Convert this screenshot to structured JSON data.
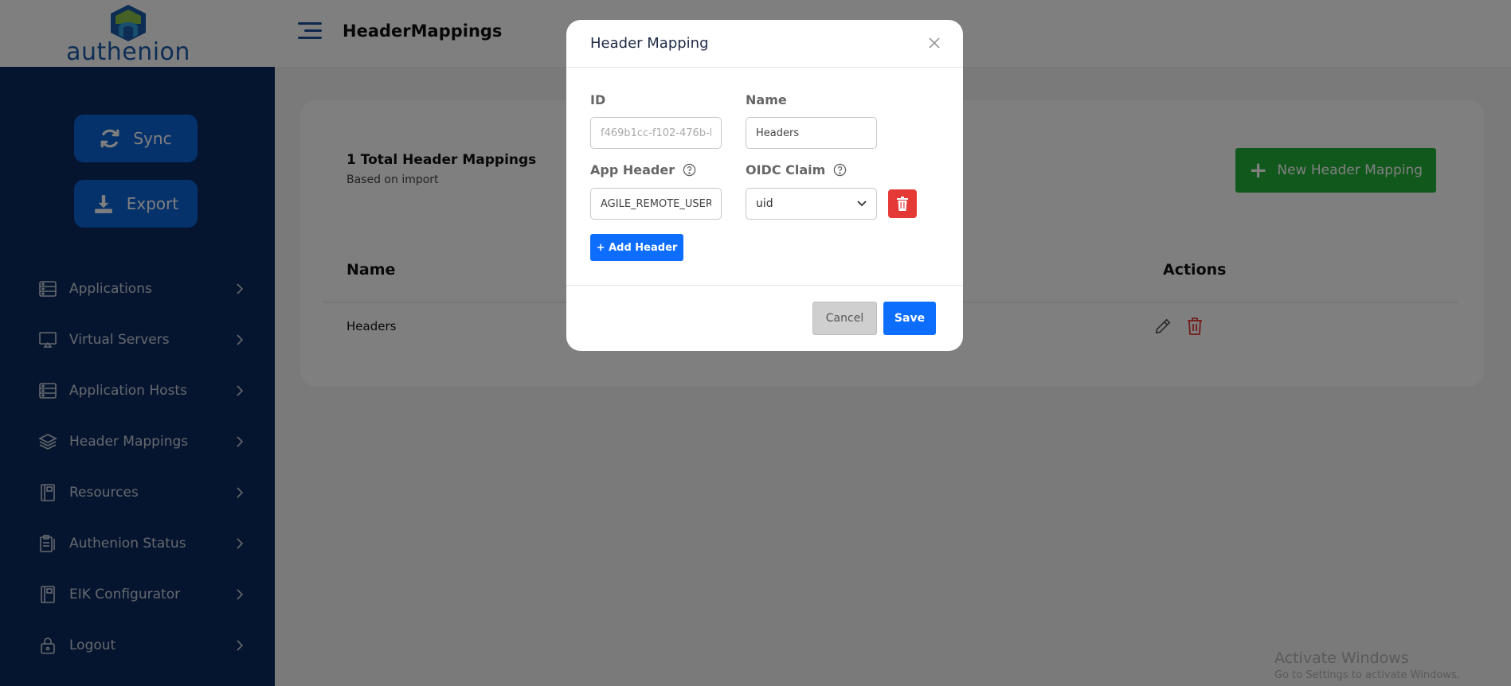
{
  "brand": {
    "logo_text": "authenion"
  },
  "header": {
    "title": "HeaderMappings",
    "menu_icon": "hamburger-icon"
  },
  "sidebar": {
    "sync_label": "Sync",
    "export_label": "Export",
    "items": [
      {
        "label": "Applications",
        "icon": "applications-icon"
      },
      {
        "label": "Virtual Servers",
        "icon": "monitor-icon"
      },
      {
        "label": "Application Hosts",
        "icon": "server-icon"
      },
      {
        "label": "Header Mappings",
        "icon": "layers-icon"
      },
      {
        "label": "Resources",
        "icon": "book-icon"
      },
      {
        "label": "Authenion Status",
        "icon": "clipboard-icon"
      },
      {
        "label": "EIK Configurator",
        "icon": "book-icon"
      },
      {
        "label": "Logout",
        "icon": "lock-icon"
      }
    ]
  },
  "main": {
    "summary_title": "1 Total Header Mappings",
    "summary_sub": "Based on import",
    "new_button_label": "New Header Mapping",
    "table": {
      "headers": {
        "name": "Name",
        "actions": "Actions"
      },
      "rows": [
        {
          "name": "Headers"
        }
      ]
    }
  },
  "watermark": {
    "title": "Activate Windows",
    "subtitle": "Go to Settings to activate Windows."
  },
  "modal": {
    "title": "Header Mapping",
    "id_label": "ID",
    "id_value": "f469b1cc-f102-476b-b",
    "name_label": "Name",
    "name_value": "Headers",
    "app_header_label": "App Header",
    "app_header_value": "AGILE_REMOTE_USER",
    "oidc_label": "OIDC Claim",
    "oidc_value": "uid",
    "add_header_label": "+ Add Header",
    "cancel_label": "Cancel",
    "save_label": "Save"
  },
  "colors": {
    "sidebar_bg": "#0d2a5e",
    "primary_blue": "#0d6efd",
    "success_green": "#22b139",
    "danger_red": "#e53935"
  }
}
